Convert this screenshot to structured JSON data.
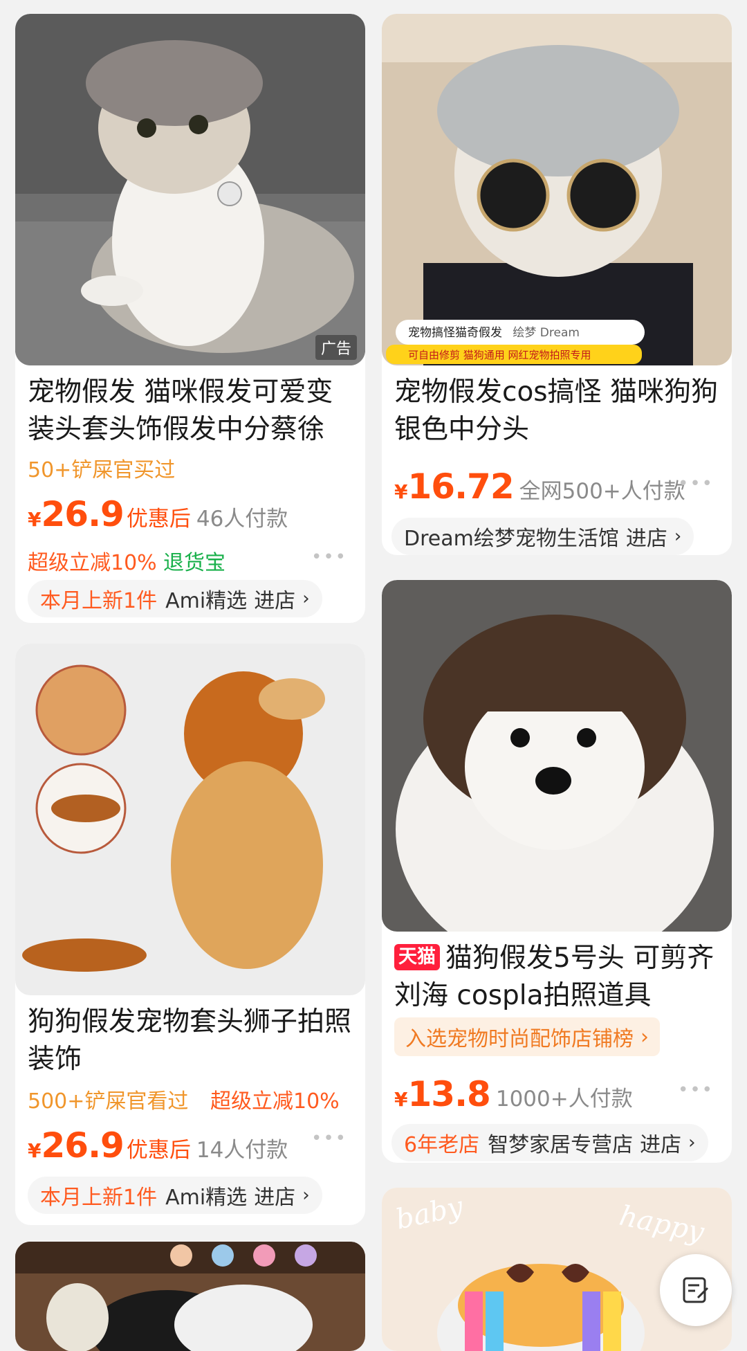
{
  "products": [
    {
      "title": "宠物假发 猫咪假发可爱变装头套头饰假发中分蔡徐",
      "hint": "50+铲屎官买过",
      "price_symbol": "¥",
      "price": "26.9",
      "after_discount": "优惠后",
      "sold": "46人付款",
      "promo1": "超级立减10%",
      "promo2": "退货宝",
      "store_tag": "本月上新1件",
      "store_name": "Ami精选",
      "store_action": "进店",
      "ad_label": "广告"
    },
    {
      "title": "宠物假发cos搞怪 猫咪狗狗银色中分头",
      "price_symbol": "¥",
      "price": "16.72",
      "sold": "全网500+人付款",
      "store_name": "Dream绘梦宠物生活馆",
      "store_action": "进店",
      "image_caption1": "宠物搞怪猫奇假发",
      "image_caption1_brand": "绘梦 Dream",
      "image_caption2": "可自由修剪 猫狗通用 网红宠物拍照专用"
    },
    {
      "title": "狗狗假发宠物套头狮子拍照装饰",
      "hint": "500+铲屎官看过",
      "hint2": "超级立减10%",
      "price_symbol": "¥",
      "price": "26.9",
      "after_discount": "优惠后",
      "sold": "14人付款",
      "store_tag": "本月上新1件",
      "store_name": "Ami精选",
      "store_action": "进店"
    },
    {
      "badge": "天猫",
      "title": "猫狗假发5号头 可剪齐刘海 cospla拍照道具",
      "rank": "入选宠物时尚配饰店铺榜",
      "price_symbol": "¥",
      "price": "13.8",
      "sold": "1000+人付款",
      "store_tag": "6年老店",
      "store_name": "智梦家居专营店",
      "store_action": "进店"
    }
  ],
  "bottom_card_text": {
    "baby": "baby",
    "happy": "happy"
  },
  "icons": {
    "more": "more-dots-icon",
    "chevron": "chevron-right-icon",
    "float": "edit-note-icon"
  },
  "colors": {
    "accent": "#ff4e0d",
    "hint": "#f0962c",
    "green": "#18b04a",
    "tmall": "#ff1f3c"
  }
}
